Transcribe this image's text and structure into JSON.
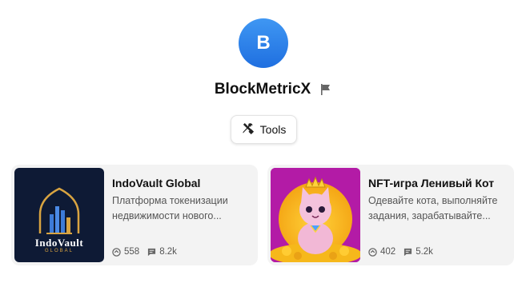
{
  "profile": {
    "avatar_letter": "B",
    "name": "BlockMetricX",
    "flag_icon": "flag-icon",
    "avatar_color": "#2f86ee"
  },
  "tools_button": {
    "label": "Tools",
    "icon": "tools-icon"
  },
  "cards": [
    {
      "title": "IndoVault Global",
      "description": "Платформа токенизации недвижимости нового...",
      "logo_text": "IndoVault",
      "logo_subtext": "GLOBAL",
      "users": "558",
      "messages": "8.2k"
    },
    {
      "title": "NFT-игра Ленивый Кот",
      "description": "Одевайте кота, выполняйте задания, зарабатывайте...",
      "users": "402",
      "messages": "5.2k"
    }
  ]
}
